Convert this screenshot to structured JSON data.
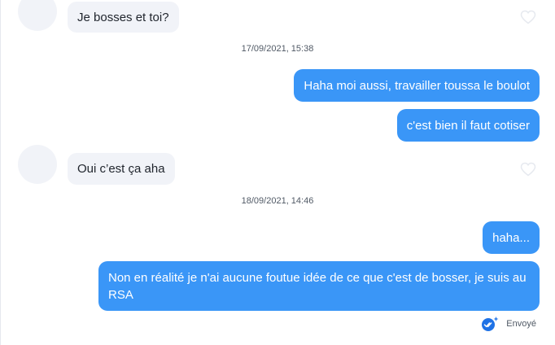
{
  "conversation": {
    "messages": [
      {
        "text": "Je bosses et toi?"
      },
      {
        "text": "Haha moi aussi, travailler toussa le boulot"
      },
      {
        "text": "c'est bien il faut cotiser"
      },
      {
        "text": "Oui c’est ça aha"
      },
      {
        "text": "haha..."
      },
      {
        "text": "Non en réalité je n'ai aucune foutue idée de ce que c'est de bosser, je suis au RSA"
      }
    ],
    "timestamps": [
      "17/09/2021, 15:38",
      "18/09/2021, 14:46"
    ],
    "status": "Envoyé"
  },
  "colors": {
    "sent_bubble": "#3a96f7",
    "received_bubble": "#f1f3f8",
    "accent": "#1f72e6"
  },
  "icons": {
    "like": "heart-outline-icon",
    "sent_status": "double-check-sparkle-icon"
  }
}
